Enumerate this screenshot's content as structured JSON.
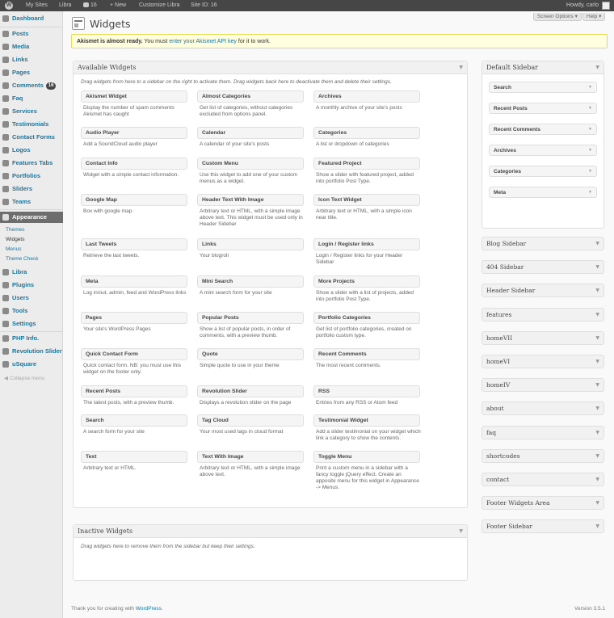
{
  "admin_bar": {
    "my_sites": "My Sites",
    "site_name": "Libra",
    "comments_count": "16",
    "new_label": "+ New",
    "customize": "Customize Libra",
    "site_id": "Site ID: 16",
    "howdy": "Howdy, carlo"
  },
  "menu": {
    "items": [
      {
        "label": "Dashboard"
      },
      {
        "label": "Posts"
      },
      {
        "label": "Media"
      },
      {
        "label": "Links"
      },
      {
        "label": "Pages"
      },
      {
        "label": "Comments",
        "count": "16"
      },
      {
        "label": "Faq"
      },
      {
        "label": "Services"
      },
      {
        "label": "Testimonials"
      },
      {
        "label": "Contact Forms"
      },
      {
        "label": "Logos"
      },
      {
        "label": "Features Tabs"
      },
      {
        "label": "Portfolios"
      },
      {
        "label": "Sliders"
      },
      {
        "label": "Teams"
      },
      {
        "label": "Appearance"
      },
      {
        "label": "Libra"
      },
      {
        "label": "Plugins"
      },
      {
        "label": "Users"
      },
      {
        "label": "Tools"
      },
      {
        "label": "Settings"
      },
      {
        "label": "PHP Info."
      },
      {
        "label": "Revolution Slider"
      },
      {
        "label": "uSquare"
      }
    ],
    "appearance_sub": [
      "Themes",
      "Widgets",
      "Menus",
      "Theme Check"
    ],
    "collapse": "Collapse menu"
  },
  "screen_options": "Screen Options ▾",
  "help": "Help ▾",
  "page_title": "Widgets",
  "notice": {
    "bold": "Akismet is almost ready.",
    "text": " You must ",
    "link": "enter your Akismet API key",
    "after": " for it to work."
  },
  "available": {
    "title": "Available Widgets",
    "description": "Drag widgets from here to a sidebar on the right to activate them. Drag widgets back here to deactivate them and delete their settings.",
    "widgets": [
      {
        "title": "Akismet Widget",
        "desc": "Display the number of spam comments Akismet has caught"
      },
      {
        "title": "Almost Categories",
        "desc": "Get list of categories, without categories excluded from options panel."
      },
      {
        "title": "Archives",
        "desc": "A monthly archive of your site's posts"
      },
      {
        "title": "Audio Player",
        "desc": "Add a SoundCloud audio player"
      },
      {
        "title": "Calendar",
        "desc": "A calendar of your site's posts"
      },
      {
        "title": "Categories",
        "desc": "A list or dropdown of categories"
      },
      {
        "title": "Contact Info",
        "desc": "Widget with a simple contact information."
      },
      {
        "title": "Custom Menu",
        "desc": "Use this widget to add one of your custom menus as a widget."
      },
      {
        "title": "Featured Project",
        "desc": "Show a slider with featured project, added into portfolio Post Type."
      },
      {
        "title": "Google Map",
        "desc": "Box with google map."
      },
      {
        "title": "Header Text With Image",
        "desc": "Arbitrary text or HTML, with a simple image above text. This widget must be used only in Header Sidebar"
      },
      {
        "title": "Icon Text Widget",
        "desc": "Arbitrary text or HTML, with a simple icon near title."
      },
      {
        "title": "Last Tweets",
        "desc": "Retrieve the last tweets."
      },
      {
        "title": "Links",
        "desc": "Your blogroll"
      },
      {
        "title": "Login / Register links",
        "desc": "Login / Register links for your Header Sidebar"
      },
      {
        "title": "Meta",
        "desc": "Log in/out, admin, feed and WordPress links"
      },
      {
        "title": "Mini Search",
        "desc": "A mini search form for your site"
      },
      {
        "title": "More Projects",
        "desc": "Show a slider with a list of projects, added into portfolio Post Type."
      },
      {
        "title": "Pages",
        "desc": "Your site's WordPress Pages"
      },
      {
        "title": "Popular Posts",
        "desc": "Show a list of popular posts, in order of comments, with a preview thumb."
      },
      {
        "title": "Portfolio Categories",
        "desc": "Get list of portfolio categories, created on portfolio custom type."
      },
      {
        "title": "Quick Contact Form",
        "desc": "Quick contact form. NB: you must use this widget on the footer only."
      },
      {
        "title": "Quote",
        "desc": "Simple quote to use in your theme"
      },
      {
        "title": "Recent Comments",
        "desc": "The most recent comments."
      },
      {
        "title": "Recent Posts",
        "desc": "The latest posts, with a preview thumb."
      },
      {
        "title": "Revolution Slider",
        "desc": "Displays a revolution slider on the page"
      },
      {
        "title": "RSS",
        "desc": "Entries from any RSS or Atom feed"
      },
      {
        "title": "Search",
        "desc": "A search form for your site"
      },
      {
        "title": "Tag Cloud",
        "desc": "Your most used tags in cloud format"
      },
      {
        "title": "Testimonial Widget",
        "desc": "Add a slider testimonial on your widget which link a category to show the contents."
      },
      {
        "title": "Text",
        "desc": "Arbitrary text or HTML."
      },
      {
        "title": "Text With Image",
        "desc": "Arbitrary text or HTML, with a simple image above text."
      },
      {
        "title": "Toggle Menu",
        "desc": "Print a custom menu in a sidebar with a fancy toggle jQuery effect. Create an apposite menu for this widget in Appearance -> Menus."
      }
    ]
  },
  "inactive": {
    "title": "Inactive Widgets",
    "description": "Drag widgets here to remove them from the sidebar but keep their settings."
  },
  "default_sidebar": {
    "title": "Default Sidebar",
    "widgets": [
      "Search",
      "Recent Posts",
      "Recent Comments",
      "Archives",
      "Categories",
      "Meta"
    ]
  },
  "sidebars": [
    "Blog Sidebar",
    "404 Sidebar",
    "Header Sidebar",
    "features",
    "homeVII",
    "homeVI",
    "homeIV",
    "about",
    "faq",
    "shortcodes",
    "contact",
    "Footer Widgets Area",
    "Footer Sidebar"
  ],
  "footer": {
    "text": "Thank you for creating with ",
    "link": "WordPress",
    "after": ".",
    "version": "Version 3.5.1"
  }
}
